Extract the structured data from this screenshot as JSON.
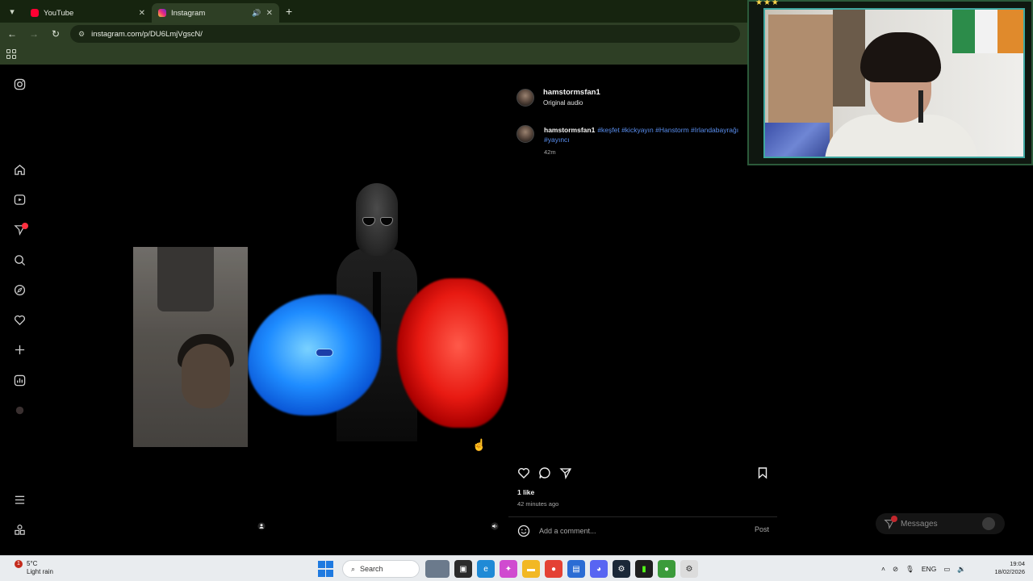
{
  "browser": {
    "tabs": [
      {
        "title": "YouTube",
        "favicon": "youtube-icon",
        "active": false
      },
      {
        "title": "Instagram",
        "favicon": "instagram-icon",
        "active": true
      }
    ],
    "url": "instagram.com/p/DU6LmjVgscN/"
  },
  "post": {
    "username": "hamstormsfan1",
    "audio": "Original audio",
    "caption_user": "hamstormsfan1",
    "caption_tags": "#keşfet #kickyayın #Hanstorm #Irlandabayrağı #yayıncı",
    "caption_time": "42m",
    "likes": "1 like",
    "posted_ago": "42 minutes ago",
    "comment_placeholder": "Add a comment...",
    "post_label": "Post"
  },
  "messages": {
    "label": "Messages",
    "badge": "1"
  },
  "sidebar": {
    "notification_count": "1"
  },
  "taskbar": {
    "weather_temp": "5°C",
    "weather_desc": "Light rain",
    "weather_badge": "1",
    "search_label": "Search",
    "language": "ENG",
    "time": "19:04",
    "date": "18/02/2026"
  },
  "colors": {
    "hashtag": "#5a8ff0",
    "chrome_green": "#2e3f25",
    "notification": "#ff3040"
  }
}
